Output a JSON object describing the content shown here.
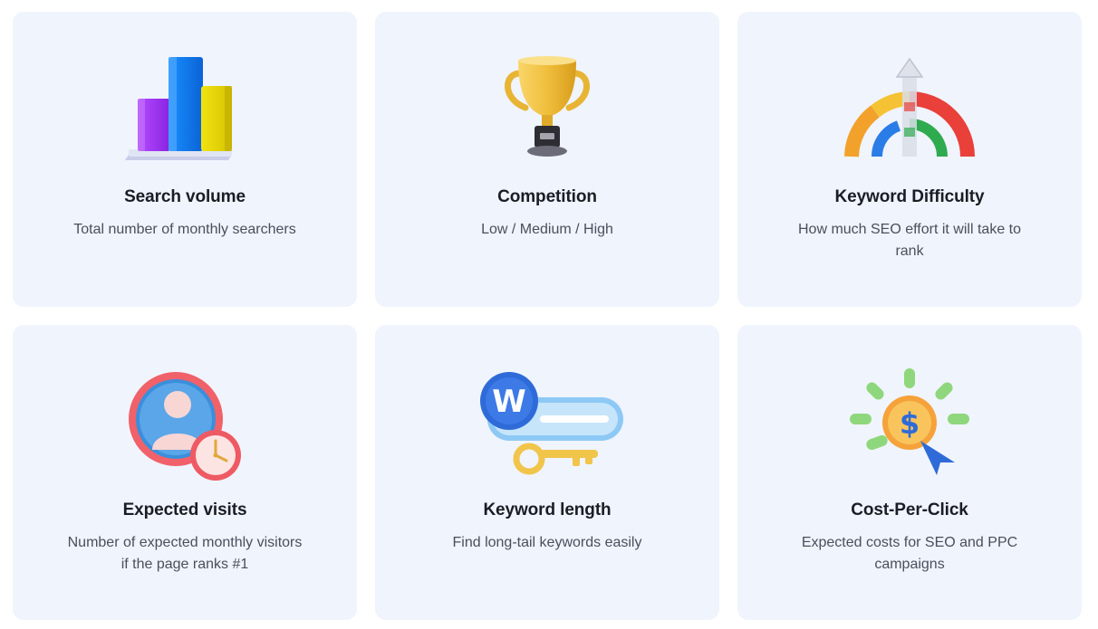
{
  "cards": [
    {
      "icon": "bar-chart-icon",
      "title": "Search volume",
      "description": "Total number of monthly searchers"
    },
    {
      "icon": "trophy-icon",
      "title": "Competition",
      "description": "Low / Medium / High"
    },
    {
      "icon": "difficulty-gauge-icon",
      "title": "Keyword Difficulty",
      "description": "How much SEO effort it will take to rank"
    },
    {
      "icon": "user-clock-icon",
      "title": "Expected visits",
      "description": "Number of expected monthly visitors if the page ranks #1"
    },
    {
      "icon": "key-search-icon",
      "title": "Keyword length",
      "description": "Find long-tail keywords easily"
    },
    {
      "icon": "dollar-coin-click-icon",
      "title": "Cost-Per-Click",
      "description": "Expected costs for SEO and PPC campaigns"
    }
  ],
  "colors": {
    "card_background": "#f0f4fd",
    "title": "#1b1d24",
    "description": "#4a4f5c"
  }
}
